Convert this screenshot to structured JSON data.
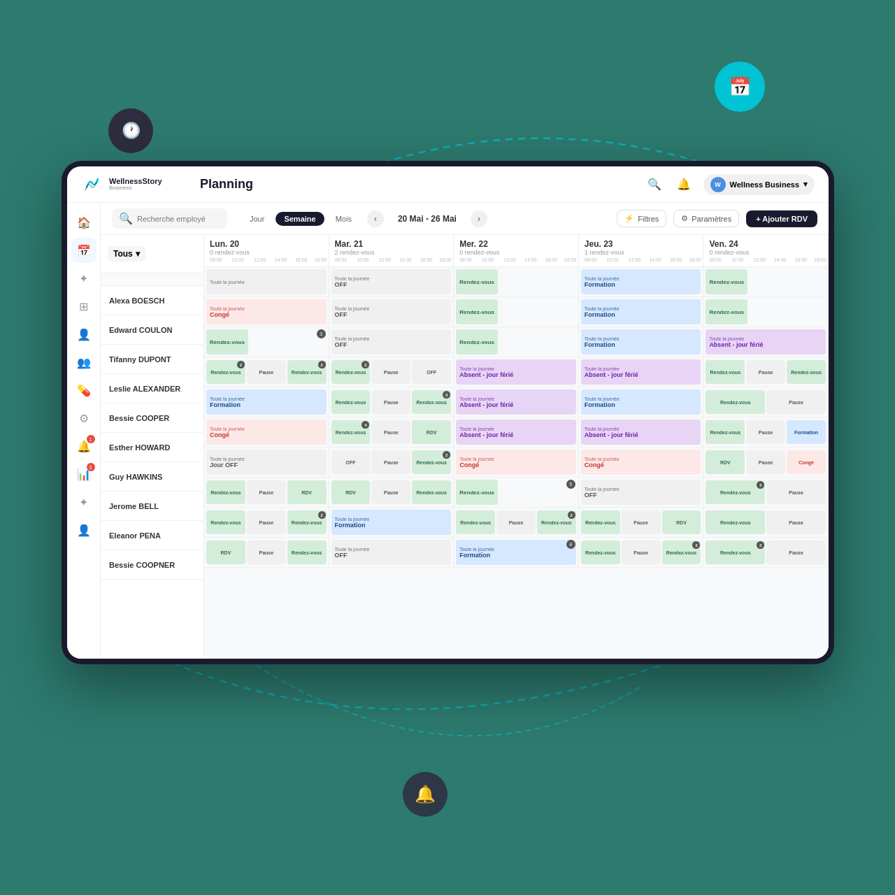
{
  "app": {
    "brand": "WellnessStory",
    "sub": "Business",
    "title": "Planning",
    "business_name": "Wellness Business",
    "business_initial": "W"
  },
  "toolbar": {
    "search_placeholder": "Recherche employé",
    "view_day": "Jour",
    "view_week": "Semaine",
    "view_month": "Mois",
    "date_range": "20 Mai - 26 Mai",
    "filter_label": "Filtres",
    "params_label": "Paramètres",
    "add_label": "+ Ajouter RDV"
  },
  "filter_dropdown": {
    "label": "Tous"
  },
  "days": [
    {
      "name": "Lun. 20",
      "rdv": "0 rendez-vous"
    },
    {
      "name": "Mar. 21",
      "rdv": "2 rendez-vous"
    },
    {
      "name": "Mer. 22",
      "rdv": "0 rendez-vous"
    },
    {
      "name": "Jeu. 23",
      "rdv": "1 rendez-vous"
    },
    {
      "name": "Ven. 24",
      "rdv": "0 rendez-vous"
    }
  ],
  "employees": [
    {
      "name": "Alexa BOESCH"
    },
    {
      "name": "Edward COULON"
    },
    {
      "name": "Tifanny DUPONT"
    },
    {
      "name": "Leslie ALEXANDER"
    },
    {
      "name": "Bessie COOPER"
    },
    {
      "name": "Esther HOWARD"
    },
    {
      "name": "Guy HAWKINS"
    },
    {
      "name": "Jerome BELL"
    },
    {
      "name": "Eleanor PENA"
    },
    {
      "name": "Bessie COOPNER"
    }
  ],
  "schedule": [
    [
      {
        "type": "full",
        "label": "Toute la journée",
        "sub": "",
        "color": "ev-gray",
        "badge": ""
      },
      {
        "type": "full",
        "label": "Toute la journée",
        "sub": "OFF",
        "color": "ev-gray",
        "badge": ""
      },
      {
        "type": "short",
        "label": "Rendez-vous",
        "sub": "",
        "color": "ev-green",
        "badge": ""
      },
      {
        "type": "full",
        "label": "Toute la journée",
        "sub": "Formation",
        "color": "ev-blue",
        "badge": ""
      },
      {
        "type": "short",
        "label": "Rendez-vous",
        "sub": "",
        "color": "ev-green",
        "badge": ""
      }
    ],
    [
      {
        "type": "full",
        "label": "Toute la journée",
        "sub": "Congé",
        "color": "ev-red",
        "badge": ""
      },
      {
        "type": "full",
        "label": "Toute la journée",
        "sub": "OFF",
        "color": "ev-gray",
        "badge": ""
      },
      {
        "type": "short",
        "label": "Rendez-vous",
        "sub": "",
        "color": "ev-green",
        "badge": ""
      },
      {
        "type": "full",
        "label": "Toute la journée",
        "sub": "Formation",
        "color": "ev-blue",
        "badge": ""
      },
      {
        "type": "short",
        "label": "Rendez-vous",
        "sub": "",
        "color": "ev-green",
        "badge": ""
      }
    ],
    [
      {
        "type": "short",
        "label": "Rendez-vous",
        "sub": "",
        "color": "ev-green",
        "badge": "3"
      },
      {
        "type": "full",
        "label": "Toute la journée",
        "sub": "OFF",
        "color": "ev-gray",
        "badge": ""
      },
      {
        "type": "short",
        "label": "Rendez-vous",
        "sub": "",
        "color": "ev-green",
        "badge": ""
      },
      {
        "type": "full",
        "label": "Toute la journée",
        "sub": "Formation",
        "color": "ev-blue",
        "badge": ""
      },
      {
        "type": "full",
        "label": "Toute la journée",
        "sub": "Absent - jour férié",
        "color": "ev-purple",
        "badge": ""
      }
    ],
    [
      {
        "type": "multi",
        "events": [
          {
            "l": "Rendez-vous",
            "c": "ev-green",
            "b": "2"
          },
          {
            "l": "Pause",
            "c": "ev-gray",
            "b": ""
          },
          {
            "l": "Rendez-vous",
            "c": "ev-green",
            "b": "2"
          }
        ],
        "color": "ev-green",
        "badge": ""
      },
      {
        "type": "multi",
        "events": [
          {
            "l": "Rendez-vous",
            "c": "ev-green",
            "b": "2"
          },
          {
            "l": "Pause",
            "c": "ev-gray",
            "b": ""
          },
          {
            "l": "OFF",
            "c": "ev-gray",
            "b": ""
          }
        ],
        "color": "ev-green",
        "badge": ""
      },
      {
        "type": "full",
        "label": "Toute la journée",
        "sub": "Absent - jour férié",
        "color": "ev-purple",
        "badge": ""
      },
      {
        "type": "full",
        "label": "Toute la journée",
        "sub": "Absent - jour férié",
        "color": "ev-purple",
        "badge": ""
      },
      {
        "type": "multi",
        "events": [
          {
            "l": "Rendez-vous",
            "c": "ev-green",
            "b": ""
          },
          {
            "l": "Pause",
            "c": "ev-gray",
            "b": ""
          },
          {
            "l": "Rendez-vous",
            "c": "ev-green",
            "b": ""
          }
        ],
        "color": "ev-green",
        "badge": ""
      }
    ],
    [
      {
        "type": "full",
        "label": "Toute la journée",
        "sub": "Formation",
        "color": "ev-blue",
        "badge": ""
      },
      {
        "type": "multi",
        "events": [
          {
            "l": "Rendez-vous",
            "c": "ev-green",
            "b": ""
          },
          {
            "l": "Pause",
            "c": "ev-gray",
            "b": ""
          },
          {
            "l": "Rendez-vous",
            "c": "ev-green",
            "b": "3"
          }
        ],
        "color": "ev-green",
        "badge": ""
      },
      {
        "type": "full",
        "label": "Toute la journée",
        "sub": "Absent - jour férié",
        "color": "ev-purple",
        "badge": ""
      },
      {
        "type": "full",
        "label": "Toute la journée",
        "sub": "Formation",
        "color": "ev-blue",
        "badge": ""
      },
      {
        "type": "multi",
        "events": [
          {
            "l": "Rendez-vous",
            "c": "ev-green",
            "b": ""
          },
          {
            "l": "Pause",
            "c": "ev-gray",
            "b": ""
          }
        ],
        "color": "ev-green",
        "badge": ""
      }
    ],
    [
      {
        "type": "full",
        "label": "Toute la journée",
        "sub": "Congé",
        "color": "ev-red",
        "badge": ""
      },
      {
        "type": "multi",
        "events": [
          {
            "l": "Rendez-vous",
            "c": "ev-green",
            "b": "4"
          },
          {
            "l": "Pause",
            "c": "ev-gray",
            "b": ""
          },
          {
            "l": "RDV",
            "c": "ev-green",
            "b": ""
          }
        ],
        "color": "ev-green",
        "badge": ""
      },
      {
        "type": "full",
        "label": "Toute la journée",
        "sub": "Absent - jour férié",
        "color": "ev-purple",
        "badge": ""
      },
      {
        "type": "full",
        "label": "Toute la journée",
        "sub": "Absent - jour férié",
        "color": "ev-purple",
        "badge": ""
      },
      {
        "type": "multi",
        "events": [
          {
            "l": "Rendez-vous",
            "c": "ev-green",
            "b": ""
          },
          {
            "l": "Pause",
            "c": "ev-gray",
            "b": ""
          },
          {
            "l": "Formation",
            "c": "ev-blue",
            "b": ""
          }
        ],
        "color": "ev-green",
        "badge": ""
      }
    ],
    [
      {
        "type": "full",
        "label": "Toute la journée",
        "sub": "Jour OFF",
        "color": "ev-gray",
        "badge": ""
      },
      {
        "type": "multi",
        "events": [
          {
            "l": "OFF",
            "c": "ev-gray",
            "b": ""
          },
          {
            "l": "Pause",
            "c": "ev-gray",
            "b": ""
          },
          {
            "l": "Rendez-vous",
            "c": "ev-green",
            "b": "2"
          }
        ],
        "color": "ev-green",
        "badge": ""
      },
      {
        "type": "full",
        "label": "Toute la journée",
        "sub": "Congé",
        "color": "ev-red",
        "badge": ""
      },
      {
        "type": "full",
        "label": "Toute la journée",
        "sub": "Congé",
        "color": "ev-red",
        "badge": ""
      },
      {
        "type": "multi",
        "events": [
          {
            "l": "RDV",
            "c": "ev-green",
            "b": ""
          },
          {
            "l": "Pause",
            "c": "ev-gray",
            "b": ""
          },
          {
            "l": "Congé",
            "c": "ev-red",
            "b": ""
          }
        ],
        "color": "ev-green",
        "badge": ""
      }
    ],
    [
      {
        "type": "multi",
        "events": [
          {
            "l": "Rendez-vous",
            "c": "ev-green",
            "b": ""
          },
          {
            "l": "Pause",
            "c": "ev-gray",
            "b": ""
          },
          {
            "l": "RDV",
            "c": "ev-green",
            "b": ""
          }
        ],
        "color": "ev-green",
        "badge": ""
      },
      {
        "type": "multi",
        "events": [
          {
            "l": "RDV",
            "c": "ev-green",
            "b": ""
          },
          {
            "l": "Pause",
            "c": "ev-gray",
            "b": ""
          },
          {
            "l": "Rendez-vous",
            "c": "ev-green",
            "b": ""
          }
        ],
        "color": "ev-green",
        "badge": ""
      },
      {
        "type": "short",
        "label": "Rendez-vous",
        "sub": "",
        "color": "ev-green",
        "badge": "5"
      },
      {
        "type": "full",
        "label": "Toute la journée",
        "sub": "OFF",
        "color": "ev-gray",
        "badge": ""
      },
      {
        "type": "multi",
        "events": [
          {
            "l": "Rendez-vous",
            "c": "ev-green",
            "b": "3"
          },
          {
            "l": "Pause",
            "c": "ev-gray",
            "b": ""
          }
        ],
        "color": "ev-green",
        "badge": ""
      }
    ],
    [
      {
        "type": "multi",
        "events": [
          {
            "l": "Rendez-vous",
            "c": "ev-green",
            "b": ""
          },
          {
            "l": "Pause",
            "c": "ev-gray",
            "b": ""
          },
          {
            "l": "Rendez-vous",
            "c": "ev-green",
            "b": "2"
          }
        ],
        "color": "ev-green",
        "badge": ""
      },
      {
        "type": "full",
        "label": "Toute la journée",
        "sub": "Formation",
        "color": "ev-blue",
        "badge": ""
      },
      {
        "type": "multi",
        "events": [
          {
            "l": "Rendez-vous",
            "c": "ev-green",
            "b": ""
          },
          {
            "l": "Pause",
            "c": "ev-gray",
            "b": ""
          },
          {
            "l": "Rendez-vous",
            "c": "ev-green",
            "b": "2"
          }
        ],
        "color": "ev-green",
        "badge": ""
      },
      {
        "type": "multi",
        "events": [
          {
            "l": "Rendez-vous",
            "c": "ev-green",
            "b": ""
          },
          {
            "l": "Pause",
            "c": "ev-gray",
            "b": ""
          },
          {
            "l": "RDV",
            "c": "ev-green",
            "b": ""
          }
        ],
        "color": "ev-green",
        "badge": ""
      },
      {
        "type": "multi",
        "events": [
          {
            "l": "Rendez-vous",
            "c": "ev-green",
            "b": ""
          },
          {
            "l": "Pause",
            "c": "ev-gray",
            "b": ""
          }
        ],
        "color": "ev-green",
        "badge": ""
      }
    ],
    [
      {
        "type": "multi",
        "events": [
          {
            "l": "RDV",
            "c": "ev-green",
            "b": ""
          },
          {
            "l": "Pause",
            "c": "ev-gray",
            "b": ""
          },
          {
            "l": "Rendez-vous",
            "c": "ev-green",
            "b": ""
          }
        ],
        "color": "ev-green",
        "badge": ""
      },
      {
        "type": "full",
        "label": "Toute la journée",
        "sub": "OFF",
        "color": "ev-gray",
        "badge": ""
      },
      {
        "type": "full",
        "label": "Toute la journée",
        "sub": "Formation",
        "color": "ev-blue",
        "badge": "4"
      },
      {
        "type": "multi",
        "events": [
          {
            "l": "Rendez-vous",
            "c": "ev-green",
            "b": ""
          },
          {
            "l": "Pause",
            "c": "ev-gray",
            "b": ""
          },
          {
            "l": "Rendez-vous",
            "c": "ev-green",
            "b": "3"
          }
        ],
        "color": "ev-green",
        "badge": ""
      },
      {
        "type": "multi",
        "events": [
          {
            "l": "Rendez-vous",
            "c": "ev-green",
            "b": "3"
          },
          {
            "l": "Pause",
            "c": "ev-gray",
            "b": ""
          }
        ],
        "color": "ev-green",
        "badge": ""
      }
    ]
  ],
  "sidebar_items": [
    {
      "icon": "🏠",
      "label": "home",
      "active": false
    },
    {
      "icon": "📅",
      "label": "calendar",
      "active": true
    },
    {
      "icon": "✦",
      "label": "sparkle",
      "active": false
    },
    {
      "icon": "⊞",
      "label": "grid",
      "active": false
    },
    {
      "icon": "👤",
      "label": "user",
      "active": false
    },
    {
      "icon": "👥",
      "label": "users",
      "active": false
    },
    {
      "icon": "💊",
      "label": "pill",
      "active": false
    },
    {
      "icon": "⚙",
      "label": "settings",
      "active": false
    },
    {
      "icon": "🔔",
      "label": "bell",
      "badge": "1",
      "active": false
    },
    {
      "icon": "📊",
      "label": "chart",
      "badge": "2",
      "active": false
    },
    {
      "icon": "✦",
      "label": "star",
      "active": false
    },
    {
      "icon": "👤",
      "label": "profile",
      "active": false
    }
  ]
}
